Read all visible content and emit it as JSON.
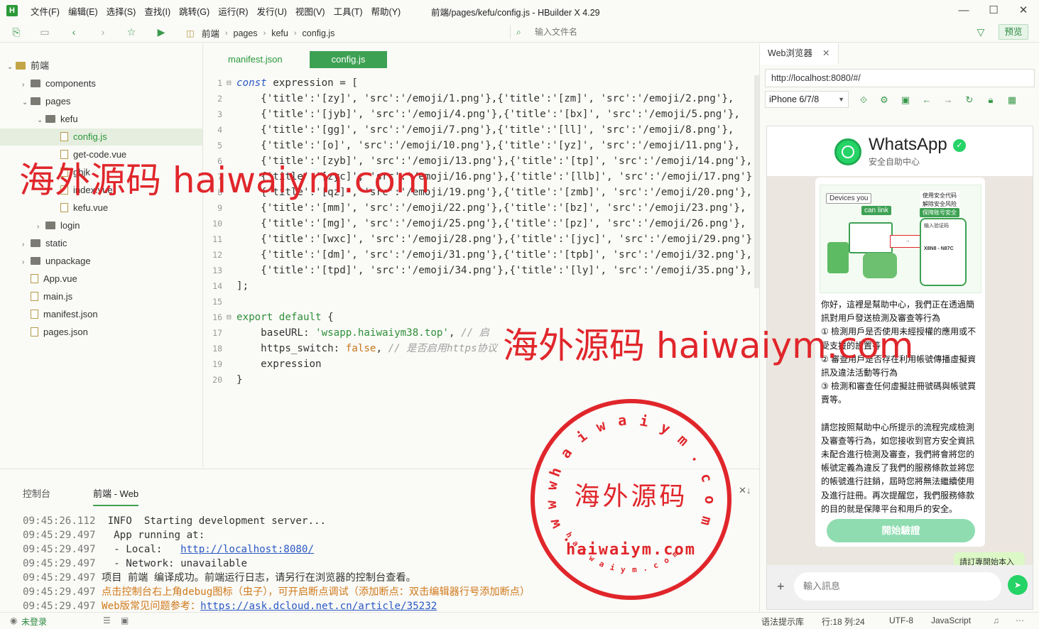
{
  "window": {
    "logo": "H",
    "title": "前端/pages/kefu/config.js - HBuilder X 4.29",
    "menu": [
      "文件(F)",
      "编辑(E)",
      "选择(S)",
      "查找(I)",
      "跳转(G)",
      "运行(R)",
      "发行(U)",
      "视图(V)",
      "工具(T)",
      "帮助(Y)"
    ]
  },
  "toolbar": {
    "breadcrumb": [
      "前端",
      "pages",
      "kefu",
      "config.js"
    ],
    "file_search_placeholder": "输入文件名",
    "preview_label": "预览"
  },
  "project_tree": [
    {
      "label": "前端",
      "type": "root",
      "depth": 0,
      "expanded": true
    },
    {
      "label": "components",
      "type": "folder",
      "depth": 1,
      "expanded": false
    },
    {
      "label": "pages",
      "type": "folder",
      "depth": 1,
      "expanded": true
    },
    {
      "label": "kefu",
      "type": "folder",
      "depth": 2,
      "expanded": true
    },
    {
      "label": "config.js",
      "type": "file",
      "depth": 3,
      "selected": true
    },
    {
      "label": "get-code.vue",
      "type": "file",
      "depth": 3
    },
    {
      "label": "ghjk",
      "type": "file",
      "depth": 3
    },
    {
      "label": "index.vue",
      "type": "file",
      "depth": 3
    },
    {
      "label": "kefu.vue",
      "type": "file",
      "depth": 3
    },
    {
      "label": "login",
      "type": "folder",
      "depth": 2,
      "expanded": false
    },
    {
      "label": "static",
      "type": "folder",
      "depth": 1,
      "expanded": false
    },
    {
      "label": "unpackage",
      "type": "folder",
      "depth": 1,
      "expanded": false
    },
    {
      "label": "App.vue",
      "type": "file",
      "depth": 1
    },
    {
      "label": "main.js",
      "type": "file",
      "depth": 1
    },
    {
      "label": "manifest.json",
      "type": "file",
      "depth": 1
    },
    {
      "label": "pages.json",
      "type": "file",
      "depth": 1
    }
  ],
  "editor": {
    "tabs": [
      "manifest.json",
      "config.js"
    ],
    "active_tab": "config.js",
    "lines": [
      {
        "n": "1",
        "fold": "⊟",
        "parts": [
          [
            "kw",
            "const"
          ],
          [
            "t",
            " expression = ["
          ]
        ]
      },
      {
        "n": "2",
        "parts": [
          [
            "t",
            "    {'title':'[zy]', 'src':'/emoji/1.png'},{'title':'[zm]', 'src':'/emoji/2.png'},"
          ]
        ]
      },
      {
        "n": "3",
        "parts": [
          [
            "t",
            "    {'title':'[jyb]', 'src':'/emoji/4.png'},{'title':'[bx]', 'src':'/emoji/5.png'},"
          ]
        ]
      },
      {
        "n": "4",
        "parts": [
          [
            "t",
            "    {'title':'[gg]', 'src':'/emoji/7.png'},{'title':'[ll]', 'src':'/emoji/8.png'},"
          ]
        ]
      },
      {
        "n": "5",
        "parts": [
          [
            "t",
            "    {'title':'[o]', 'src':'/emoji/10.png'},{'title':'[yz]', 'src':'/emoji/11.png'},"
          ]
        ]
      },
      {
        "n": "6",
        "parts": [
          [
            "t",
            "    {'title':'[zyb]', 'src':'/emoji/13.png'},{'title':'[tp]', 'src':'/emoji/14.png'},"
          ]
        ]
      },
      {
        "n": "7",
        "parts": [
          [
            "t",
            "    {'title':'[zyc]', 'src':'/emoji/16.png'},{'title':'[llb]', 'src':'/emoji/17.png'},"
          ]
        ]
      },
      {
        "n": "8",
        "parts": [
          [
            "t",
            "    {'title':'[qz]', 'src':'/emoji/19.png'},{'title':'[zmb]', 'src':'/emoji/20.png'},"
          ]
        ]
      },
      {
        "n": "9",
        "parts": [
          [
            "t",
            "    {'title':'[mm]', 'src':'/emoji/22.png'},{'title':'[bz]', 'src':'/emoji/23.png'},"
          ]
        ]
      },
      {
        "n": "10",
        "parts": [
          [
            "t",
            "    {'title':'[mg]', 'src':'/emoji/25.png'},{'title':'[pz]', 'src':'/emoji/26.png'},"
          ]
        ]
      },
      {
        "n": "11",
        "parts": [
          [
            "t",
            "    {'title':'[wxc]', 'src':'/emoji/28.png'},{'title':'[jyc]', 'src':'/emoji/29.png'},"
          ]
        ]
      },
      {
        "n": "12",
        "parts": [
          [
            "t",
            "    {'title':'[dm]', 'src':'/emoji/31.png'},{'title':'[tpb]', 'src':'/emoji/32.png'},"
          ]
        ]
      },
      {
        "n": "13",
        "parts": [
          [
            "t",
            "    {'title':'[tpd]', 'src':'/emoji/34.png'},{'title':'[ly]', 'src':'/emoji/35.png'},"
          ]
        ]
      },
      {
        "n": "14",
        "parts": [
          [
            "t",
            "];"
          ]
        ]
      },
      {
        "n": "15",
        "parts": []
      },
      {
        "n": "16",
        "fold": "⊟",
        "parts": [
          [
            "kw2",
            "export default"
          ],
          [
            "t",
            " {"
          ]
        ]
      },
      {
        "n": "17",
        "parts": [
          [
            "t",
            "    baseURL: "
          ],
          [
            "str",
            "'wsapp.haiwaiym38.top'"
          ],
          [
            "t",
            ", "
          ],
          [
            "cmt",
            "// 启"
          ]
        ]
      },
      {
        "n": "18",
        "parts": [
          [
            "t",
            "    https_switch: "
          ],
          [
            "bool",
            "false"
          ],
          [
            "t",
            ", "
          ],
          [
            "cmt",
            "// 是否启用https协议"
          ]
        ]
      },
      {
        "n": "19",
        "parts": [
          [
            "t",
            "    expression"
          ]
        ]
      },
      {
        "n": "20",
        "parts": [
          [
            "t",
            "}"
          ]
        ]
      }
    ]
  },
  "console": {
    "tabs": [
      "控制台",
      "前端 - Web"
    ],
    "active_tab": "前端 - Web",
    "lines": [
      [
        [
          "time",
          "09:45:26.112"
        ],
        [
          "t",
          "  INFO  Starting development server..."
        ]
      ],
      [
        [
          "time",
          "09:45:29.497"
        ],
        [
          "t",
          "   App running at:"
        ]
      ],
      [
        [
          "time",
          "09:45:29.497"
        ],
        [
          "t",
          "   - Local:   "
        ],
        [
          "link",
          "http://localhost:8080/"
        ]
      ],
      [
        [
          "time",
          "09:45:29.497"
        ],
        [
          "t",
          "   - Network: unavailable"
        ]
      ],
      [
        [
          "time",
          "09:45:29.497"
        ],
        [
          "t",
          " 项目 前端 编译成功。前端运行日志，请另行在浏览器的控制台查看。"
        ]
      ],
      [
        [
          "time",
          "09:45:29.497"
        ],
        [
          "orange",
          " 点击控制台右上角debug图标（虫子），可开启断点调试（添加断点：双击编辑器行号添加断点）"
        ]
      ],
      [
        [
          "time",
          "09:45:29.497"
        ],
        [
          "orange",
          " Web版常见问题参考："
        ],
        [
          "link",
          "https://ask.dcloud.net.cn/article/35232"
        ]
      ]
    ]
  },
  "statusbar": {
    "login": "未登录",
    "syntax_hint": "语法提示库",
    "position": "行:18  列:24",
    "encoding": "UTF-8",
    "language": "JavaScript"
  },
  "browser": {
    "tab_label": "Web浏览器",
    "url": "http://localhost:8080/#/",
    "device": "iPhone 6/7/8",
    "page": {
      "brand": "WhatsApp",
      "subtitle": "安全自助中心",
      "image_tags": [
        "Devices you",
        "can link",
        "使用安全代码",
        "解除安全风险",
        "保障账号安全",
        "输入验证码"
      ],
      "image_code": "X8N8 - N87C",
      "paragraph_1": "你好，這裡是幫助中心，我們正在透過簡訊對用戶發送檢測及審查等行為",
      "items": [
        "① 檢測用戶是否使用未經授權的應用或不受支援的設置等",
        "② 審查用戶是否存在利用帳號傳播虛擬資訊及違法活動等行為",
        "③ 檢測和審查任何虛擬註冊號碼與帳號買賣等。"
      ],
      "paragraph_2": "請您按照幫助中心所提示的流程完成檢測及審查等行為，如您接收到官方安全資訊未配合進行檢測及審查，我們將會將您的帳號定義為違反了我們的服務條款並將您的帳號進行註銷，屆時您將無法繼續使用及進行註冊。再次提醒您，我們服務條款的目的就是保障平台和用戶的安全。",
      "button": "開始驗證",
      "bubble": "請訂專開始本入",
      "input_placeholder": "輸入訊息"
    }
  },
  "watermarks": {
    "text_1": "海外源码 haiwaiym.com",
    "text_2": "海外源码 haiwaiym.com",
    "stamp_center": "海外源码",
    "stamp_domain": "haiwaiym.com",
    "stamp_ring": "haiwaiym.com",
    "stamp_small": "haiwaiym.com",
    "stamp_www": "www."
  },
  "colors": {
    "accent": "#3da153",
    "whatsapp_green": "#25d366",
    "watermark_red": "#e0262b",
    "keyword_blue": "#2b59c3"
  }
}
